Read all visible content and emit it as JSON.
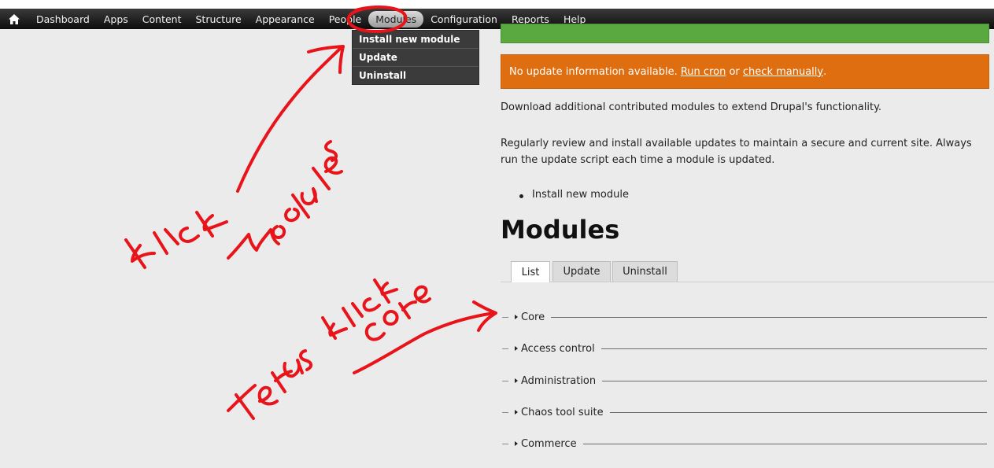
{
  "toolbar": {
    "items": [
      {
        "label": "Dashboard"
      },
      {
        "label": "Apps"
      },
      {
        "label": "Content"
      },
      {
        "label": "Structure"
      },
      {
        "label": "Appearance"
      },
      {
        "label": "People"
      },
      {
        "label": "Modules"
      },
      {
        "label": "Configuration"
      },
      {
        "label": "Reports"
      },
      {
        "label": "Help"
      }
    ]
  },
  "dropdown": {
    "items": [
      {
        "label": "Install new module"
      },
      {
        "label": "Update"
      },
      {
        "label": "Uninstall"
      }
    ]
  },
  "messages": {
    "warning_text": "No update information available. ",
    "run_cron": "Run cron",
    "or_text": " or ",
    "check_manually": "check manually",
    "end": "."
  },
  "content": {
    "para1": "Download additional contributed modules to extend Drupal's functionality.",
    "para2": "Regularly review and install available updates to maintain a secure and current site. Always run the update script each time a module is updated.",
    "bullet": "Install new module",
    "title": "Modules"
  },
  "tabs": [
    {
      "label": "List"
    },
    {
      "label": "Update"
    },
    {
      "label": "Uninstall"
    }
  ],
  "fieldsets": [
    {
      "label": "Core"
    },
    {
      "label": "Access control"
    },
    {
      "label": "Administration"
    },
    {
      "label": "Chaos tool suite"
    },
    {
      "label": "Commerce"
    }
  ],
  "colors": {
    "accent_annotation": "#e8141a",
    "warning": "#df6e10",
    "status": "#5aa840"
  }
}
